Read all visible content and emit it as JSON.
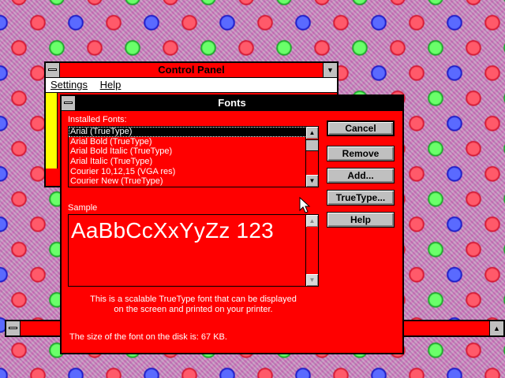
{
  "control_panel": {
    "title": "Control Panel",
    "menu": [
      "Settings",
      "Help"
    ]
  },
  "fonts_dialog": {
    "title": "Fonts",
    "installed_label": "Installed Fonts:",
    "installed_fonts": [
      "Arial (TrueType)",
      "Arial Bold (TrueType)",
      "Arial Bold Italic (TrueType)",
      "Arial Italic (TrueType)",
      "Courier 10,12,15 (VGA res)",
      "Courier New (TrueType)"
    ],
    "selected_index": 0,
    "sample_label": "Sample",
    "sample_text": "AaBbCcXxYyZz 123",
    "description_line1": "This is a scalable TrueType font that can be displayed",
    "description_line2": "on the screen and printed on your printer.",
    "size_text": "The size of the font on the disk is:  67 KB.",
    "buttons": {
      "cancel": "Cancel",
      "remove": "Remove",
      "add": "Add...",
      "truetype": "TrueType...",
      "help": "Help"
    }
  },
  "colors": {
    "window_bg": "#ff0000",
    "active_title": "#000000",
    "button_face": "#c0c0c0"
  }
}
